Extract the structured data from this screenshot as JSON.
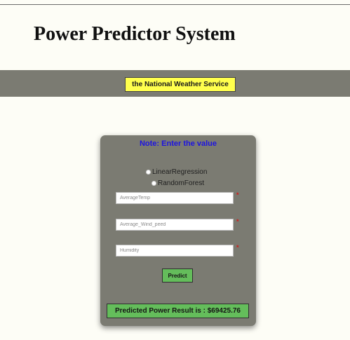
{
  "header": {
    "title": "Power Predictor System"
  },
  "nav": {
    "link_label": "the National Weather Service"
  },
  "form": {
    "note": "Note: Enter the value",
    "models": [
      {
        "label": "LinearRegression",
        "selected": false
      },
      {
        "label": "RandomForest",
        "selected": false
      }
    ],
    "fields": [
      {
        "placeholder": "AverageTemp",
        "value": "",
        "required_mark": "*"
      },
      {
        "placeholder": "Average_Wind_peed",
        "value": "",
        "required_mark": "*"
      },
      {
        "placeholder": "Humidity",
        "value": "",
        "required_mark": "*"
      }
    ],
    "predict_label": "Predict",
    "result_text": "Predicted Power Result is : $69425.76"
  },
  "colors": {
    "page_bg": "#fdfdf6",
    "bar_bg": "#7b7b72",
    "link_bg": "#ffff4d",
    "note_text": "#1d14e0",
    "button_green": "#64bd5b",
    "required_red": "#d11b1b"
  }
}
